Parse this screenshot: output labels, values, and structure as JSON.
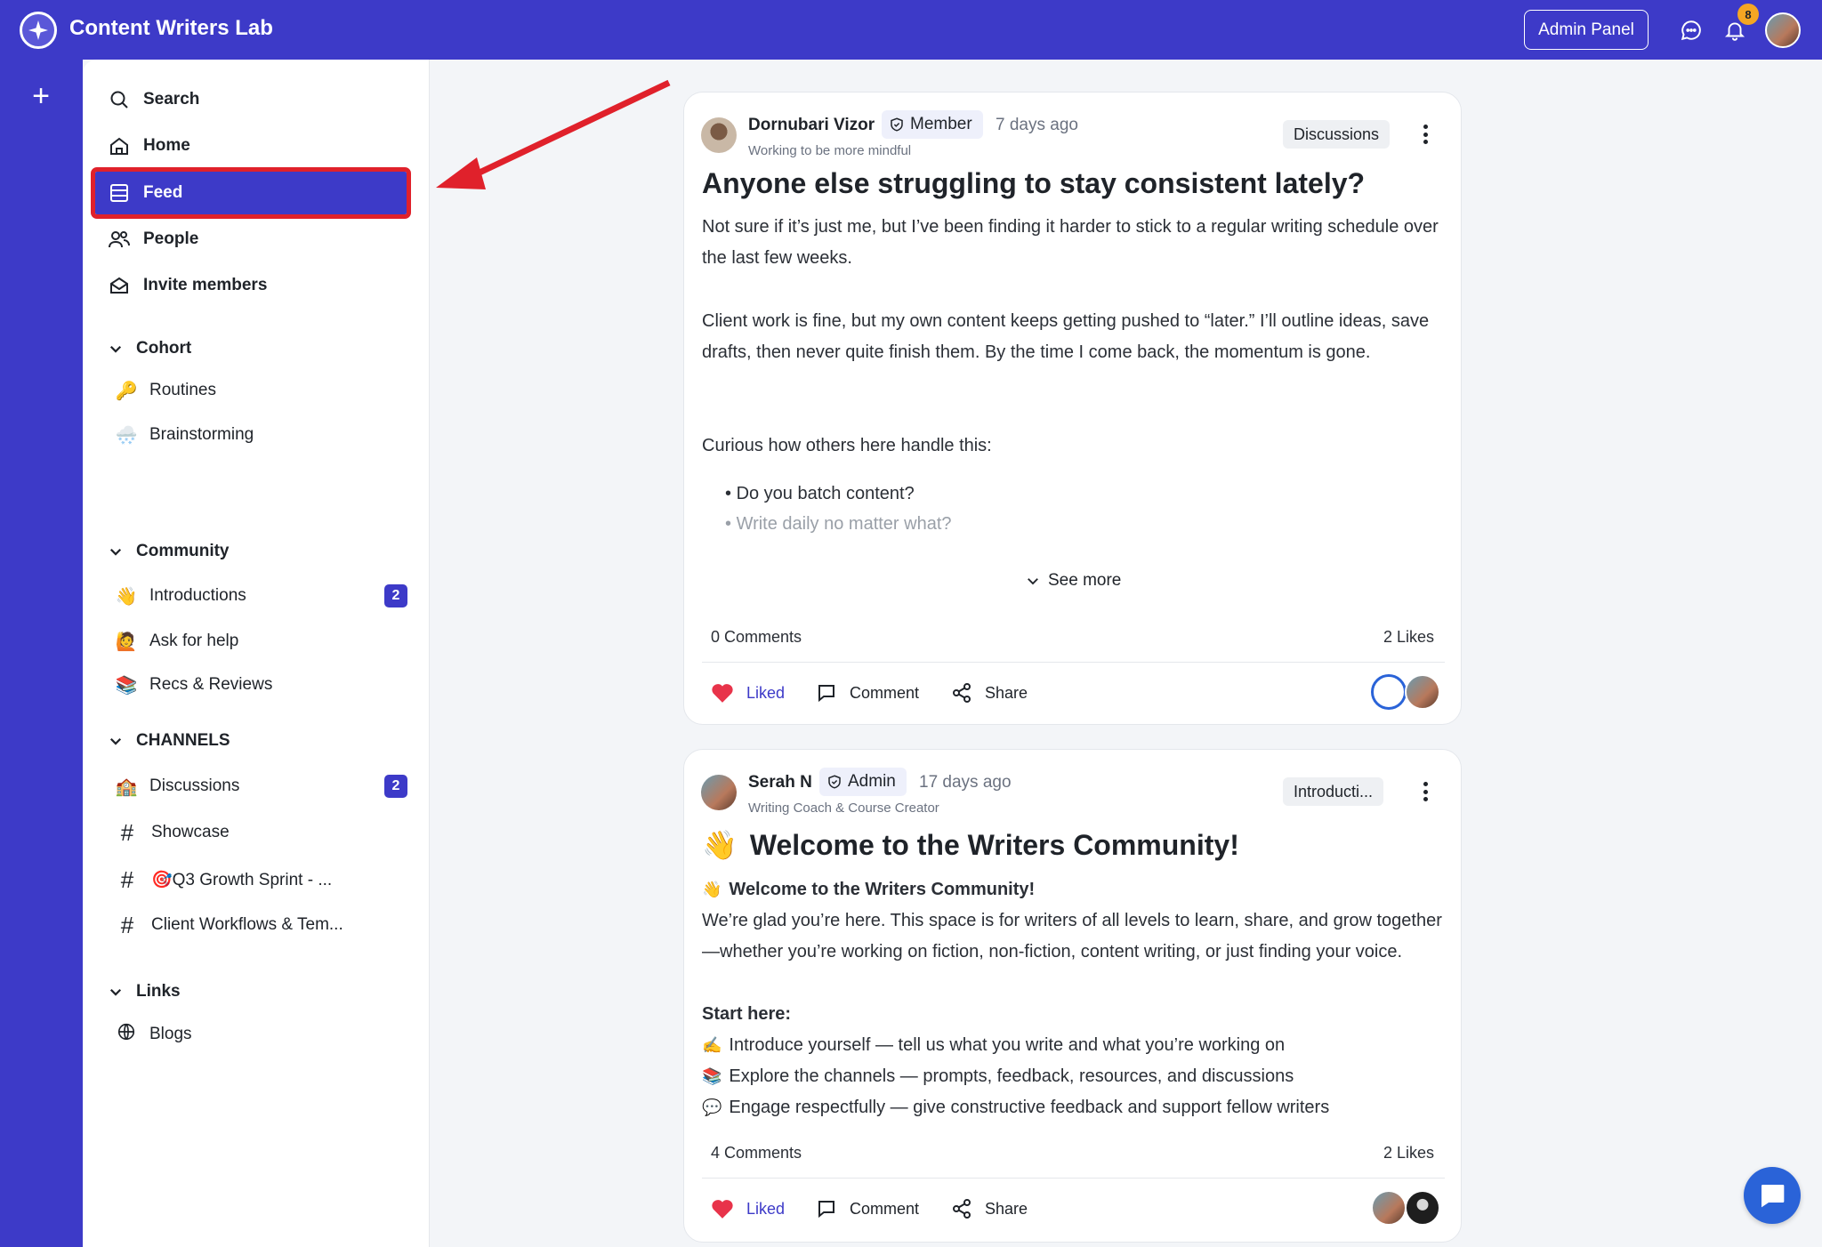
{
  "app": {
    "title": "Content Writers Lab"
  },
  "header": {
    "admin_label": "Admin Panel",
    "notification_count": "8"
  },
  "sidebar": {
    "nav": [
      {
        "label": "Search",
        "icon": "search-icon"
      },
      {
        "label": "Home",
        "icon": "home-icon"
      },
      {
        "label": "Feed",
        "icon": "feed-icon"
      },
      {
        "label": "People",
        "icon": "people-icon"
      },
      {
        "label": "Invite members",
        "icon": "mail-icon"
      }
    ],
    "sections": [
      {
        "title": "Cohort",
        "items": [
          {
            "label": "Routines",
            "emoji": "🔑"
          },
          {
            "label": "Brainstorming",
            "emoji": "🌨️"
          }
        ]
      },
      {
        "title": "Community",
        "items": [
          {
            "label": "Introductions",
            "emoji": "👋",
            "count": "2"
          },
          {
            "label": "Ask for help",
            "emoji": "🙋"
          },
          {
            "label": "Recs & Reviews",
            "emoji": "📚"
          }
        ]
      },
      {
        "title": "CHANNELS",
        "items": [
          {
            "label": "Discussions",
            "emoji": "🏫",
            "count": "2"
          },
          {
            "label": "Showcase",
            "hash": "#"
          },
          {
            "label": "🎯Q3 Growth Sprint - ...",
            "hash": "#"
          },
          {
            "label": "Client Workflows & Tem...",
            "hash": "#"
          }
        ]
      },
      {
        "title": "Links",
        "items": [
          {
            "label": "Blogs",
            "icon": "globe-icon"
          }
        ]
      }
    ]
  },
  "posts": [
    {
      "author": "Dornubari Vizor",
      "role": "Member",
      "time": "7 days ago",
      "subtitle": "Working to be more mindful",
      "tag": "Discussions",
      "title": "Anyone else struggling to stay consistent lately?",
      "paragraphs": [
        "Not sure if it’s just me, but I’ve been finding it harder to stick to a regular writing schedule over the last few weeks.",
        "Client work is fine, but my own content keeps getting pushed to “later.” I’ll outline ideas, save drafts, then never quite finish them. By the time I come back, the momentum is gone.",
        "Curious how others here handle this:"
      ],
      "bullets": [
        "Do you batch content?",
        "Write daily no matter what?"
      ],
      "see_more": "See more",
      "comments": "0 Comments",
      "likes": "2 Likes",
      "actions": {
        "liked": "Liked",
        "comment": "Comment",
        "share": "Share"
      }
    },
    {
      "author": "Serah N",
      "role": "Admin",
      "time": "17 days ago",
      "subtitle": "Writing Coach & Course Creator",
      "tag": "Introducti...",
      "title_emoji": "👋",
      "title": "Welcome to the Writers Community!",
      "heading_emoji": "👋",
      "heading": "Welcome to the Writers Community!",
      "intro": "We’re glad you’re here. This space is for writers of all levels to learn, share, and grow together—whether you’re working on fiction, non-fiction, content writing, or just finding your voice.",
      "start_here": "Start here:",
      "steps": [
        {
          "emoji": "✍️",
          "text": "Introduce yourself — tell us what you write and what you’re working on"
        },
        {
          "emoji": "📚",
          "text": "Explore the channels — prompts, feedback, resources, and discussions"
        },
        {
          "emoji": "💬",
          "text": "Engage respectfully — give constructive feedback and support fellow writers"
        }
      ],
      "comments": "4 Comments",
      "likes": "2 Likes",
      "actions": {
        "liked": "Liked",
        "comment": "Comment",
        "share": "Share"
      }
    }
  ]
}
